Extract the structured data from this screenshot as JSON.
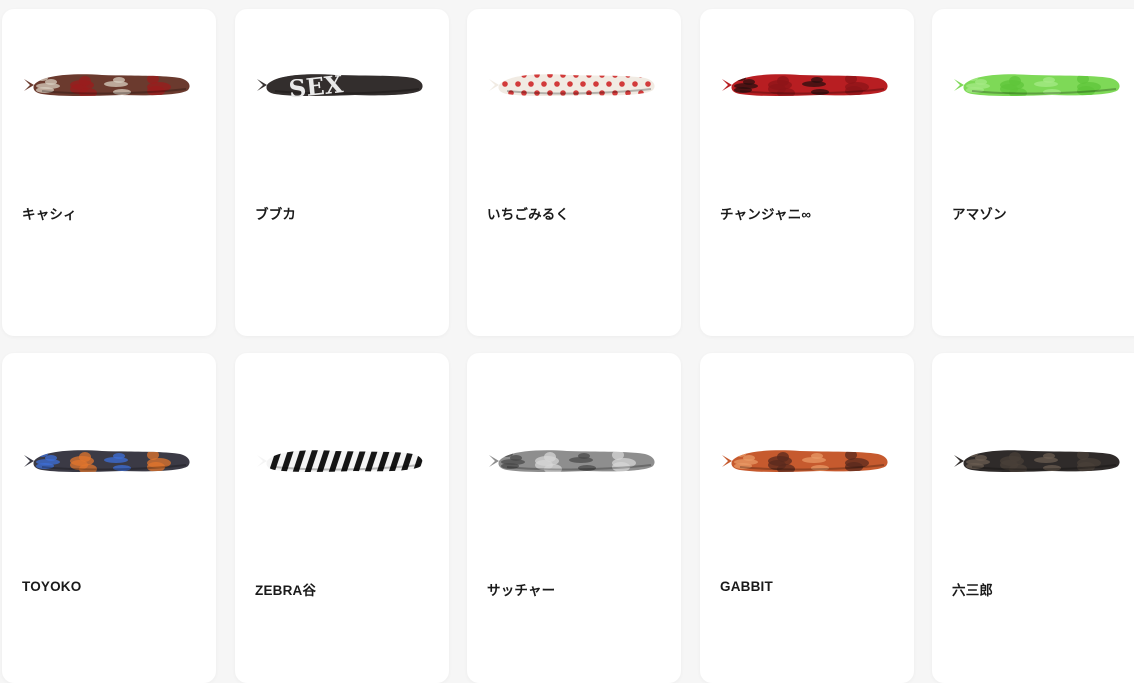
{
  "products": [
    {
      "name": "キャシィ",
      "image_label": "",
      "colors": {
        "base": "#6b3a2e",
        "accent": "#9b1c1c",
        "spot": "#d8cfc0"
      }
    },
    {
      "name": "ブブカ",
      "image_label": "SEX",
      "colors": {
        "base": "#3a3534",
        "accent": "#2a2524",
        "spot": "#e9e9e9"
      }
    },
    {
      "name": "いちごみるく",
      "image_label": "",
      "colors": {
        "base": "#f1ebe3",
        "accent": "#e04a4a",
        "spot": "#d23b3b"
      }
    },
    {
      "name": "チャンジャニ∞",
      "image_label": "",
      "colors": {
        "base": "#b81e22",
        "accent": "#8c1418",
        "spot": "#2a0f0f"
      }
    },
    {
      "name": "アマゾン",
      "image_label": "",
      "colors": {
        "base": "#7ed957",
        "accent": "#5fc43a",
        "spot": "#a6ea86"
      }
    },
    {
      "name": "TOYOKO",
      "image_label": "",
      "colors": {
        "base": "#3b3a45",
        "accent": "#e2752d",
        "spot": "#3e6fd8"
      }
    },
    {
      "name": "ZEBRA谷",
      "image_label": "",
      "colors": {
        "base": "#f4f4f4",
        "accent": "#151515",
        "spot": "#151515"
      }
    },
    {
      "name": "サッチャー",
      "image_label": "",
      "colors": {
        "base": "#8e8e8e",
        "accent": "#d6d6d6",
        "spot": "#4a4a4a"
      }
    },
    {
      "name": "GABBIT",
      "image_label": "",
      "colors": {
        "base": "#c65a2e",
        "accent": "#5a2a1e",
        "spot": "#e89a66"
      }
    },
    {
      "name": "六三郎",
      "image_label": "",
      "colors": {
        "base": "#2f2b2a",
        "accent": "#4a4038",
        "spot": "#6b5e52"
      }
    }
  ]
}
